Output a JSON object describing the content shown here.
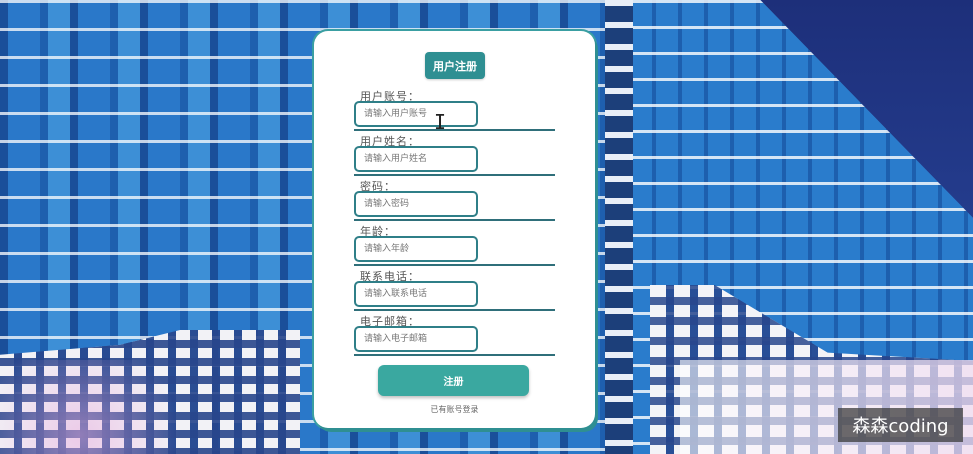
{
  "register": {
    "title": "用户注册",
    "fields": [
      {
        "label": "用户账号：",
        "placeholder": "请输入用户账号"
      },
      {
        "label": "用户姓名：",
        "placeholder": "请输入用户姓名"
      },
      {
        "label": "密码：",
        "placeholder": "请输入密码"
      },
      {
        "label": "年龄：",
        "placeholder": "请输入年龄"
      },
      {
        "label": "联系电话：",
        "placeholder": "请输入联系电话"
      },
      {
        "label": "电子邮箱：",
        "placeholder": "请输入电子邮箱"
      }
    ],
    "submit_label": "注册",
    "login_link": "已有账号登录"
  },
  "watermark": "森森coding",
  "colors": {
    "accent": "#2f8f92",
    "button": "#3aa8a0"
  }
}
